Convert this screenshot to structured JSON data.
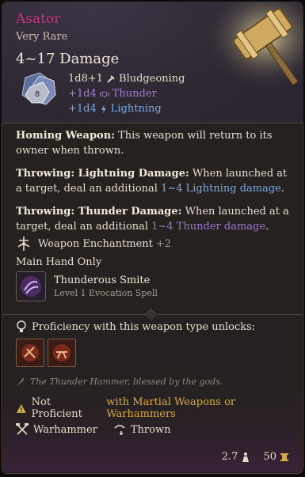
{
  "item": {
    "name": "Asator",
    "rarity": "Very Rare",
    "damage_summary": "4~17 Damage",
    "base_damage": "1d8+1",
    "base_damage_type": "Bludgeoning",
    "extra_thunder": "+1d4",
    "extra_thunder_type": "Thunder",
    "extra_lightning": "+1d4",
    "extra_lightning_type": "Lightning",
    "die_value": "8"
  },
  "description": {
    "homing_title": "Homing Weapon:",
    "homing_text": " This weapon will return to its owner when thrown.",
    "lightning_title": "Throwing: Lightning Damage:",
    "lightning_text": " When launched at a target, deal an additional ",
    "lightning_link": "1~4 Lightning damage",
    "lightning_end": ".",
    "thunder_title": "Throwing: Thunder Damage:",
    "thunder_text": " When launched at a target, deal an additional ",
    "thunder_link": "1~4 Thunder damage",
    "thunder_end": "."
  },
  "enchantment": {
    "label": "Weapon Enchantment",
    "value": "+2"
  },
  "main_hand": "Main Hand Only",
  "spell": {
    "name": "Thunderous Smite",
    "subtitle": "Level 1 Evocation Spell"
  },
  "proficiency": {
    "label": "Proficiency with this weapon type unlocks:"
  },
  "flavor": "The Thunder Hammer, blessed by the gods.",
  "not_proficient": {
    "label": "Not Proficient",
    "detail": "with Martial Weapons or Warhammers"
  },
  "properties": [
    {
      "label": "Warhammer",
      "icon": "crossed-hammers-icon"
    },
    {
      "label": "Thrown",
      "icon": "thrown-icon"
    }
  ],
  "footer": {
    "weight": "2.7",
    "weight_icon": "weight-icon",
    "value": "50",
    "value_icon": "gold-icon"
  },
  "colors": {
    "title": "#c3327d",
    "lightning": "#7aa9e3",
    "thunder": "#9d77cf",
    "warning": "#d9a941"
  }
}
